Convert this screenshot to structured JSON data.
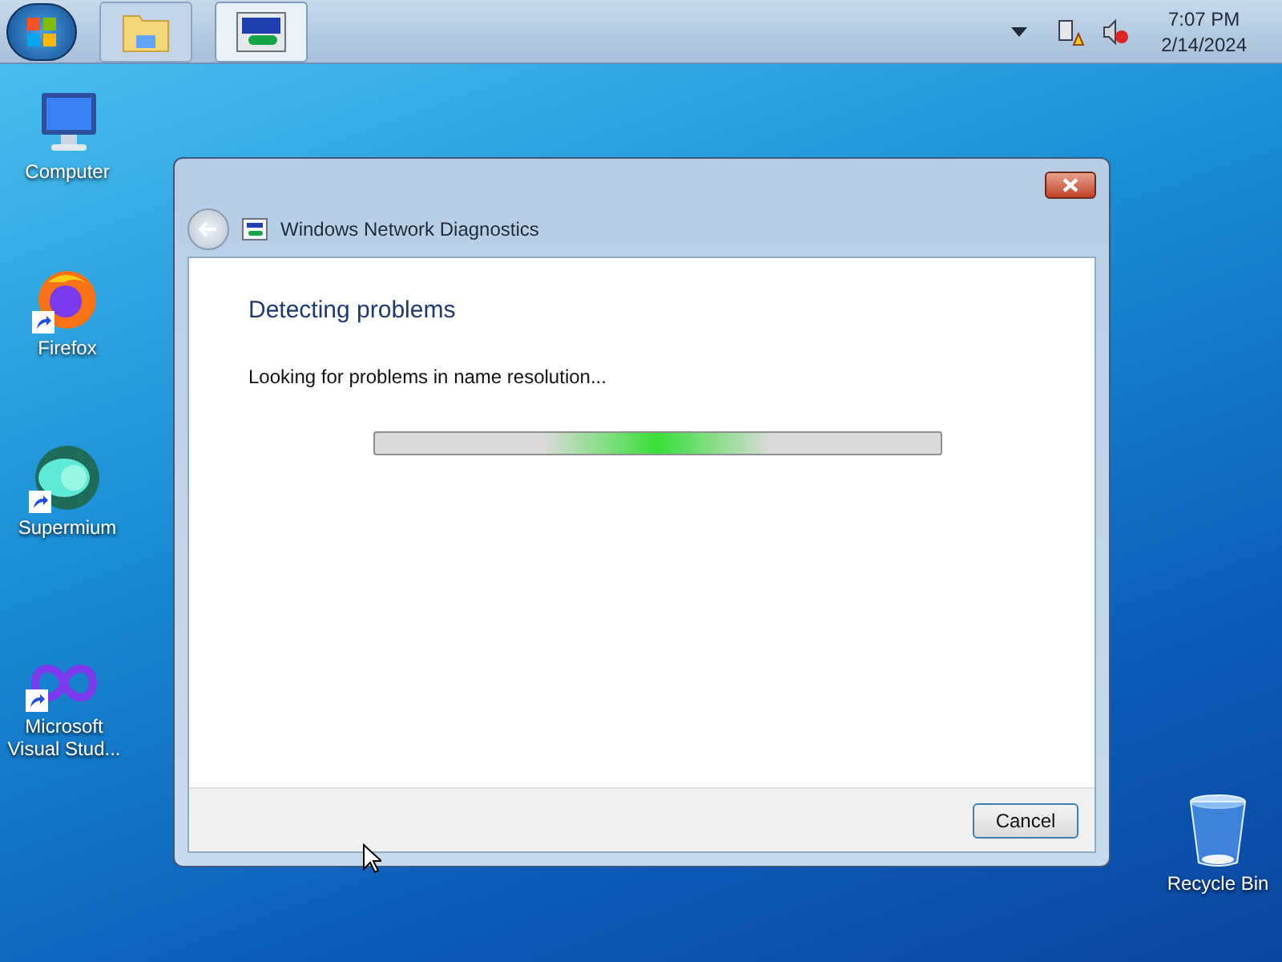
{
  "taskbar": {
    "buttons": [
      {
        "kind": "folder",
        "selected": false
      },
      {
        "kind": "network",
        "selected": true
      }
    ],
    "clock": {
      "time": "7:07 PM",
      "date": "2/14/2024"
    }
  },
  "desktop_icons": [
    {
      "kind": "computer",
      "label": "Computer",
      "shortcut": false
    },
    {
      "kind": "firefox",
      "label": "Firefox",
      "shortcut": true
    },
    {
      "kind": "supermium",
      "label": "Supermium",
      "shortcut": true
    },
    {
      "kind": "visualstudio",
      "label": "Microsoft Visual Stud...",
      "shortcut": true
    },
    {
      "kind": "recyclebin",
      "label": "Recycle Bin",
      "shortcut": false
    }
  ],
  "window": {
    "title": "Windows Network Diagnostics",
    "heading": "Detecting problems",
    "status": "Looking for problems in name resolution...",
    "progress": {
      "indeterminate": true
    },
    "buttons": [
      "Cancel"
    ]
  }
}
